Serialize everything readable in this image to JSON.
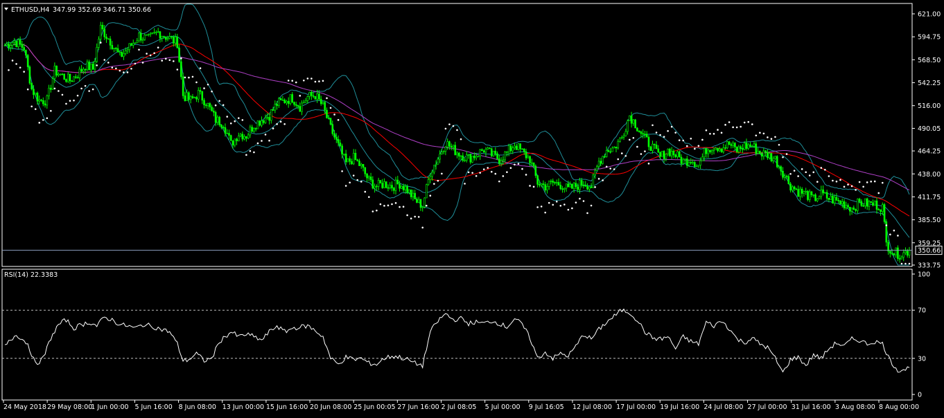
{
  "header": {
    "symbol": "ETHUSD,H4",
    "ohlc": "347.99 352.69 346.71 350.66"
  },
  "rsi_label": "RSI(14) 22.3383",
  "current_price_label": "350.66",
  "colors": {
    "background": "#000000",
    "frame": "#ffffff",
    "bull_candle": "#00ff00",
    "bear_candle": "#00ff00",
    "bollinger": "#1f8f9a",
    "ma_fast": "#ff0000",
    "ma_slow": "#b040c8",
    "parabolic_sar": "#ffffff",
    "rsi_line": "#ffffff",
    "current_price_line": "#8d9fc0"
  },
  "chart_data": [
    {
      "type": "candlestick",
      "symbol": "ETHUSD",
      "timeframe": "H4",
      "last": 350.66,
      "ylim": [
        333.75,
        621.0
      ],
      "yticks": [
        621.0,
        594.75,
        568.5,
        542.25,
        516.0,
        490.05,
        464.25,
        438.0,
        411.75,
        385.5,
        359.25,
        333.75
      ],
      "ytick_labels": [
        "621.00",
        "594.75",
        "568.50",
        "542.25",
        "516.00",
        "490.05",
        "464.25",
        "438.00",
        "411.75",
        "385.50",
        "359.25",
        "333.75"
      ],
      "xtick_labels": [
        "24 May 2018",
        "29 May 08:00",
        "1 Jun 00:00",
        "5 Jun 16:00",
        "8 Jun 08:00",
        "13 Jun 00:00",
        "15 Jun 16:00",
        "20 Jun 08:00",
        "25 Jun 00:05",
        "27 Jun 16:00",
        "2 Jul 08:05",
        "5 Jul 00:00",
        "9 Jul 16:05",
        "12 Jul 08:00",
        "17 Jul 00:00",
        "19 Jul 16:00",
        "24 Jul 08:00",
        "27 Jul 00:00",
        "31 Jul 16:00",
        "3 Aug 08:00",
        "8 Aug 00:00"
      ],
      "close_path": [
        [
          0,
          585
        ],
        [
          5,
          590
        ],
        [
          10,
          582
        ],
        [
          14,
          535
        ],
        [
          18,
          522
        ],
        [
          22,
          522
        ],
        [
          26,
          556
        ],
        [
          30,
          550
        ],
        [
          34,
          545
        ],
        [
          38,
          552
        ],
        [
          42,
          562
        ],
        [
          46,
          558
        ],
        [
          50,
          605
        ],
        [
          55,
          590
        ],
        [
          60,
          572
        ],
        [
          65,
          583
        ],
        [
          70,
          596
        ],
        [
          75,
          592
        ],
        [
          80,
          600
        ],
        [
          85,
          594
        ],
        [
          90,
          588
        ],
        [
          93,
          528
        ],
        [
          97,
          522
        ],
        [
          101,
          530
        ],
        [
          105,
          520
        ],
        [
          110,
          500
        ],
        [
          114,
          496
        ],
        [
          118,
          472
        ],
        [
          122,
          484
        ],
        [
          126,
          482
        ],
        [
          130,
          494
        ],
        [
          134,
          500
        ],
        [
          138,
          505
        ],
        [
          142,
          518
        ],
        [
          146,
          522
        ],
        [
          150,
          525
        ],
        [
          154,
          515
        ],
        [
          158,
          526
        ],
        [
          162,
          528
        ],
        [
          166,
          515
        ],
        [
          170,
          490
        ],
        [
          174,
          470
        ],
        [
          178,
          450
        ],
        [
          182,
          456
        ],
        [
          186,
          446
        ],
        [
          190,
          430
        ],
        [
          194,
          424
        ],
        [
          198,
          427
        ],
        [
          202,
          424
        ],
        [
          206,
          427
        ],
        [
          210,
          420
        ],
        [
          214,
          408
        ],
        [
          218,
          402
        ],
        [
          222,
          440
        ],
        [
          226,
          456
        ],
        [
          230,
          474
        ],
        [
          234,
          466
        ],
        [
          238,
          460
        ],
        [
          242,
          456
        ],
        [
          246,
          460
        ],
        [
          250,
          466
        ],
        [
          254,
          460
        ],
        [
          258,
          455
        ],
        [
          262,
          462
        ],
        [
          266,
          472
        ],
        [
          270,
          463
        ],
        [
          274,
          455
        ],
        [
          278,
          428
        ],
        [
          282,
          424
        ],
        [
          286,
          428
        ],
        [
          290,
          426
        ],
        [
          294,
          420
        ],
        [
          298,
          424
        ],
        [
          302,
          428
        ],
        [
          306,
          424
        ],
        [
          310,
          452
        ],
        [
          314,
          465
        ],
        [
          318,
          468
        ],
        [
          322,
          480
        ],
        [
          326,
          505
        ],
        [
          330,
          492
        ],
        [
          334,
          478
        ],
        [
          338,
          468
        ],
        [
          342,
          457
        ],
        [
          346,
          465
        ],
        [
          350,
          460
        ],
        [
          354,
          452
        ],
        [
          358,
          455
        ],
        [
          362,
          448
        ],
        [
          366,
          466
        ],
        [
          370,
          470
        ],
        [
          374,
          468
        ],
        [
          378,
          472
        ],
        [
          382,
          465
        ],
        [
          386,
          470
        ],
        [
          390,
          470
        ],
        [
          394,
          462
        ],
        [
          398,
          460
        ],
        [
          402,
          455
        ],
        [
          406,
          440
        ],
        [
          410,
          425
        ],
        [
          414,
          418
        ],
        [
          418,
          415
        ],
        [
          422,
          409
        ],
        [
          426,
          415
        ],
        [
          430,
          410
        ],
        [
          434,
          407
        ],
        [
          438,
          404
        ],
        [
          442,
          399
        ],
        [
          446,
          405
        ],
        [
          450,
          404
        ],
        [
          454,
          403
        ],
        [
          458,
          400
        ],
        [
          460,
          358
        ],
        [
          464,
          348
        ],
        [
          468,
          346
        ],
        [
          472,
          350.66
        ]
      ],
      "candle_count": 473
    },
    {
      "type": "line",
      "indicator": "RSI(14)",
      "value": 22.3383,
      "ylim": [
        0,
        100
      ],
      "ytick_labels": [
        "100",
        "70",
        "30",
        "0"
      ],
      "levels": [
        70,
        30
      ],
      "path": [
        [
          0,
          40
        ],
        [
          6,
          50
        ],
        [
          12,
          42
        ],
        [
          16,
          25
        ],
        [
          20,
          30
        ],
        [
          24,
          47
        ],
        [
          28,
          58
        ],
        [
          32,
          62
        ],
        [
          36,
          55
        ],
        [
          40,
          58
        ],
        [
          44,
          60
        ],
        [
          48,
          57
        ],
        [
          52,
          64
        ],
        [
          56,
          62
        ],
        [
          60,
          58
        ],
        [
          64,
          57
        ],
        [
          68,
          55
        ],
        [
          72,
          58
        ],
        [
          76,
          57
        ],
        [
          80,
          55
        ],
        [
          86,
          52
        ],
        [
          90,
          42
        ],
        [
          93,
          28
        ],
        [
          96,
          29
        ],
        [
          100,
          34
        ],
        [
          104,
          28
        ],
        [
          108,
          30
        ],
        [
          112,
          44
        ],
        [
          118,
          52
        ],
        [
          122,
          48
        ],
        [
          126,
          50
        ],
        [
          130,
          48
        ],
        [
          134,
          45
        ],
        [
          138,
          52
        ],
        [
          142,
          57
        ],
        [
          146,
          52
        ],
        [
          150,
          55
        ],
        [
          154,
          56
        ],
        [
          158,
          57
        ],
        [
          162,
          53
        ],
        [
          166,
          48
        ],
        [
          170,
          30
        ],
        [
          174,
          25
        ],
        [
          178,
          31
        ],
        [
          182,
          29
        ],
        [
          186,
          30
        ],
        [
          190,
          26
        ],
        [
          194,
          25
        ],
        [
          198,
          30
        ],
        [
          202,
          32
        ],
        [
          206,
          31
        ],
        [
          210,
          29
        ],
        [
          214,
          26
        ],
        [
          218,
          24
        ],
        [
          222,
          52
        ],
        [
          226,
          61
        ],
        [
          230,
          67
        ],
        [
          234,
          62
        ],
        [
          238,
          63
        ],
        [
          242,
          59
        ],
        [
          246,
          60
        ],
        [
          250,
          59
        ],
        [
          254,
          61
        ],
        [
          258,
          59
        ],
        [
          262,
          56
        ],
        [
          266,
          63
        ],
        [
          270,
          58
        ],
        [
          274,
          47
        ],
        [
          278,
          30
        ],
        [
          282,
          35
        ],
        [
          286,
          30
        ],
        [
          290,
          34
        ],
        [
          294,
          32
        ],
        [
          298,
          40
        ],
        [
          302,
          50
        ],
        [
          306,
          46
        ],
        [
          310,
          54
        ],
        [
          314,
          60
        ],
        [
          318,
          65
        ],
        [
          322,
          70
        ],
        [
          326,
          68
        ],
        [
          330,
          62
        ],
        [
          334,
          52
        ],
        [
          338,
          47
        ],
        [
          342,
          46
        ],
        [
          346,
          48
        ],
        [
          350,
          38
        ],
        [
          354,
          48
        ],
        [
          358,
          44
        ],
        [
          362,
          42
        ],
        [
          366,
          60
        ],
        [
          370,
          57
        ],
        [
          374,
          61
        ],
        [
          378,
          55
        ],
        [
          382,
          46
        ],
        [
          386,
          43
        ],
        [
          390,
          47
        ],
        [
          394,
          42
        ],
        [
          398,
          39
        ],
        [
          402,
          30
        ],
        [
          406,
          18
        ],
        [
          410,
          29
        ],
        [
          414,
          31
        ],
        [
          418,
          24
        ],
        [
          422,
          33
        ],
        [
          426,
          30
        ],
        [
          430,
          38
        ],
        [
          434,
          43
        ],
        [
          438,
          40
        ],
        [
          442,
          46
        ],
        [
          446,
          45
        ],
        [
          450,
          42
        ],
        [
          454,
          44
        ],
        [
          458,
          42
        ],
        [
          462,
          28
        ],
        [
          466,
          20
        ],
        [
          470,
          21
        ],
        [
          472,
          22.3383
        ]
      ]
    }
  ]
}
